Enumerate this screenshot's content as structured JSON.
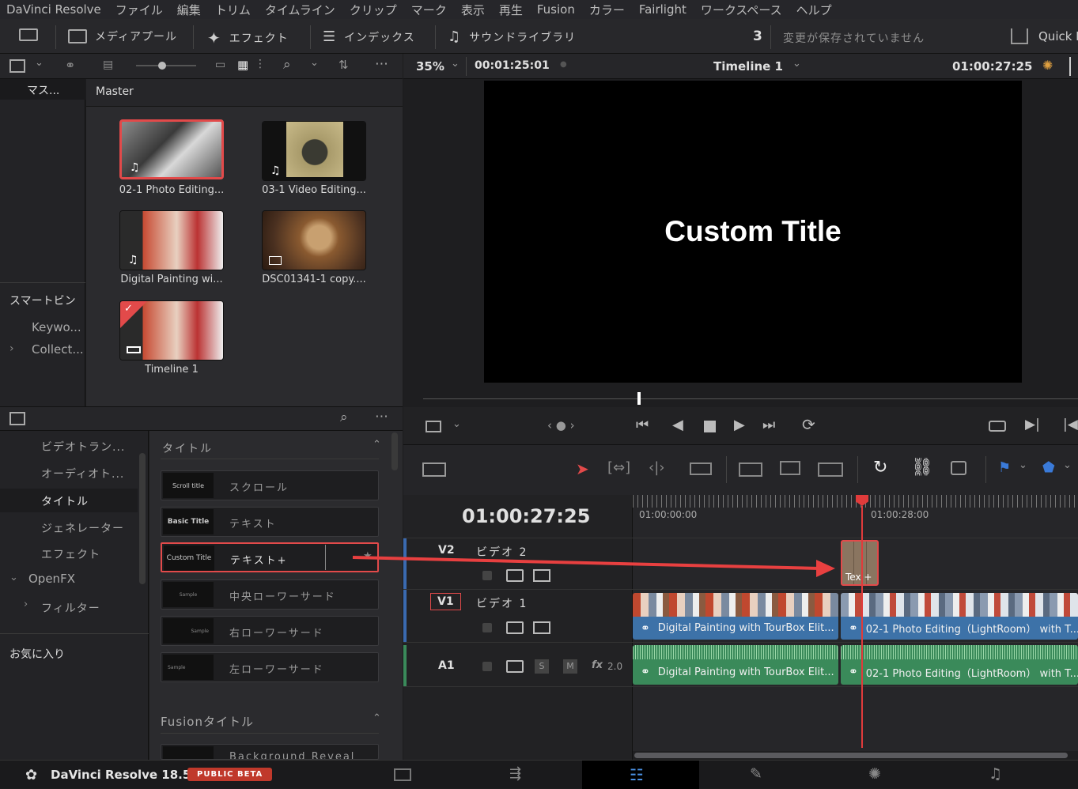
{
  "menu": [
    "DaVinci Resolve",
    "ファイル",
    "編集",
    "トリム",
    "タイムライン",
    "クリップ",
    "マーク",
    "表示",
    "再生",
    "Fusion",
    "カラー",
    "Fairlight",
    "ワークスペース",
    "ヘルプ"
  ],
  "toolbar": {
    "media_pool": "メディアプール",
    "effects": "エフェクト",
    "index": "インデックス",
    "sound_library": "サウンドライブラリ",
    "unsaved_count": "3",
    "unsaved_text": "変更が保存されていません",
    "quick_export": "Quick E"
  },
  "viewer": {
    "zoom": "35%",
    "source_tc": "00:01:25:01",
    "timeline_name": "Timeline 1",
    "record_tc": "01:00:27:25",
    "title_text": "Custom Title"
  },
  "sidebar": {
    "master": "マス...",
    "smart_bins": "スマートビン",
    "keywords": "Keywo...",
    "collections": "Collect..."
  },
  "pool": {
    "header": "Master",
    "clips": [
      {
        "label": "02-1 Photo Editing...",
        "selected": true
      },
      {
        "label": "03-1 Video Editing..."
      },
      {
        "label": "Digital Painting wi..."
      },
      {
        "label": "DSC01341-1 copy...."
      },
      {
        "label": "Timeline 1"
      }
    ]
  },
  "fx_categories": [
    "ビデオトラン...",
    "オーディオト...",
    "タイトル",
    "ジェネレーター",
    "エフェクト",
    "OpenFX",
    "フィルター",
    "お気に入り"
  ],
  "fx_section": "タイトル",
  "fx_items": [
    {
      "preview": "Scroll title",
      "label": "スクロール"
    },
    {
      "preview": "Basic Title",
      "label": "テキスト"
    },
    {
      "preview": "Custom Title",
      "label": "テキスト+"
    },
    {
      "preview": "Sample",
      "label": "中央ローワーサード"
    },
    {
      "preview": "Sample",
      "label": "右ローワーサード"
    },
    {
      "preview": "Sample",
      "label": "左ローワーサード"
    }
  ],
  "fusion_section": "Fusionタイトル",
  "fusion_item": "Background Reveal",
  "timeline": {
    "timecode": "01:00:27:25",
    "ruler": [
      "01:00:00:00",
      "01:00:28:00"
    ],
    "tracks": [
      {
        "id": "V2",
        "name": "ビデオ 2"
      },
      {
        "id": "V1",
        "name": "ビデオ 1"
      },
      {
        "id": "A1",
        "name": "",
        "level": "2.0"
      }
    ],
    "text_clip": "Tex +",
    "v1_clips": [
      "Digital Painting with TourBox Elit...",
      "02-1 Photo Editing（LightRoom） with T..."
    ],
    "a1_clips": [
      "Digital Painting with TourBox Elit...",
      "02-1 Photo Editing（LightRoom） with T..."
    ]
  },
  "footer": {
    "app": "DaVinci Resolve 18.5",
    "badge": "PUBLIC BETA"
  },
  "colors": {
    "accent_red": "#e24a4a",
    "video_clip": "#3d72a8",
    "audio_clip": "#3a8a5a",
    "playhead": "#e03b3b"
  }
}
